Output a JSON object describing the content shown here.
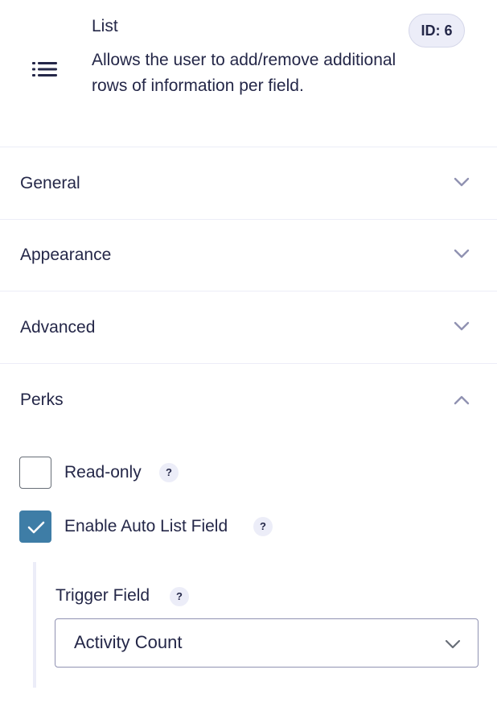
{
  "field": {
    "icon": "list-icon",
    "title": "List",
    "description": "Allows the user to add/remove additional rows of information per field.",
    "id_badge": "ID: 6"
  },
  "sections": [
    {
      "label": "General",
      "expanded": false
    },
    {
      "label": "Appearance",
      "expanded": false
    },
    {
      "label": "Advanced",
      "expanded": false
    },
    {
      "label": "Perks",
      "expanded": true
    }
  ],
  "perks": {
    "read_only": {
      "label": "Read-only",
      "checked": false,
      "help": "?"
    },
    "auto_list": {
      "label": "Enable Auto List Field",
      "checked": true,
      "help": "?"
    },
    "trigger_field": {
      "label": "Trigger Field",
      "help": "?",
      "value": "Activity Count"
    }
  },
  "colors": {
    "text": "#242748",
    "divider": "#ecedf8",
    "checkbox_checked": "#3e7da6",
    "chevron": "#9092b2"
  }
}
